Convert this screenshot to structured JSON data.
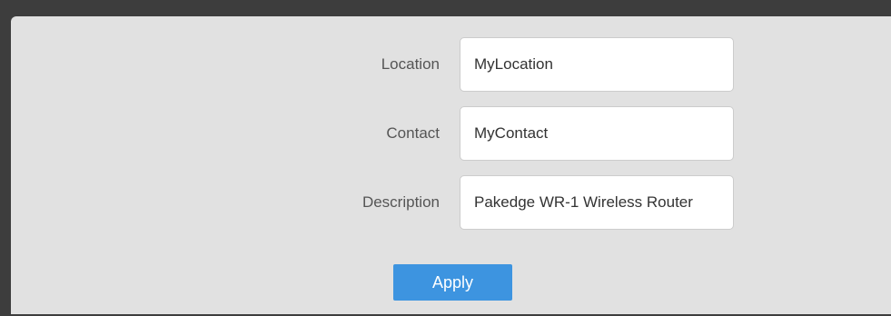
{
  "form": {
    "location": {
      "label": "Location",
      "value": "MyLocation"
    },
    "contact": {
      "label": "Contact",
      "value": "MyContact"
    },
    "description": {
      "label": "Description",
      "value": "Pakedge WR-1 Wireless Router"
    }
  },
  "actions": {
    "apply_label": "Apply"
  },
  "colors": {
    "frame": "#3d3d3d",
    "panel_background": "#e1e1e1",
    "field_background": "#ffffff",
    "label_text": "#555555",
    "apply_button": "#3d94e0"
  }
}
